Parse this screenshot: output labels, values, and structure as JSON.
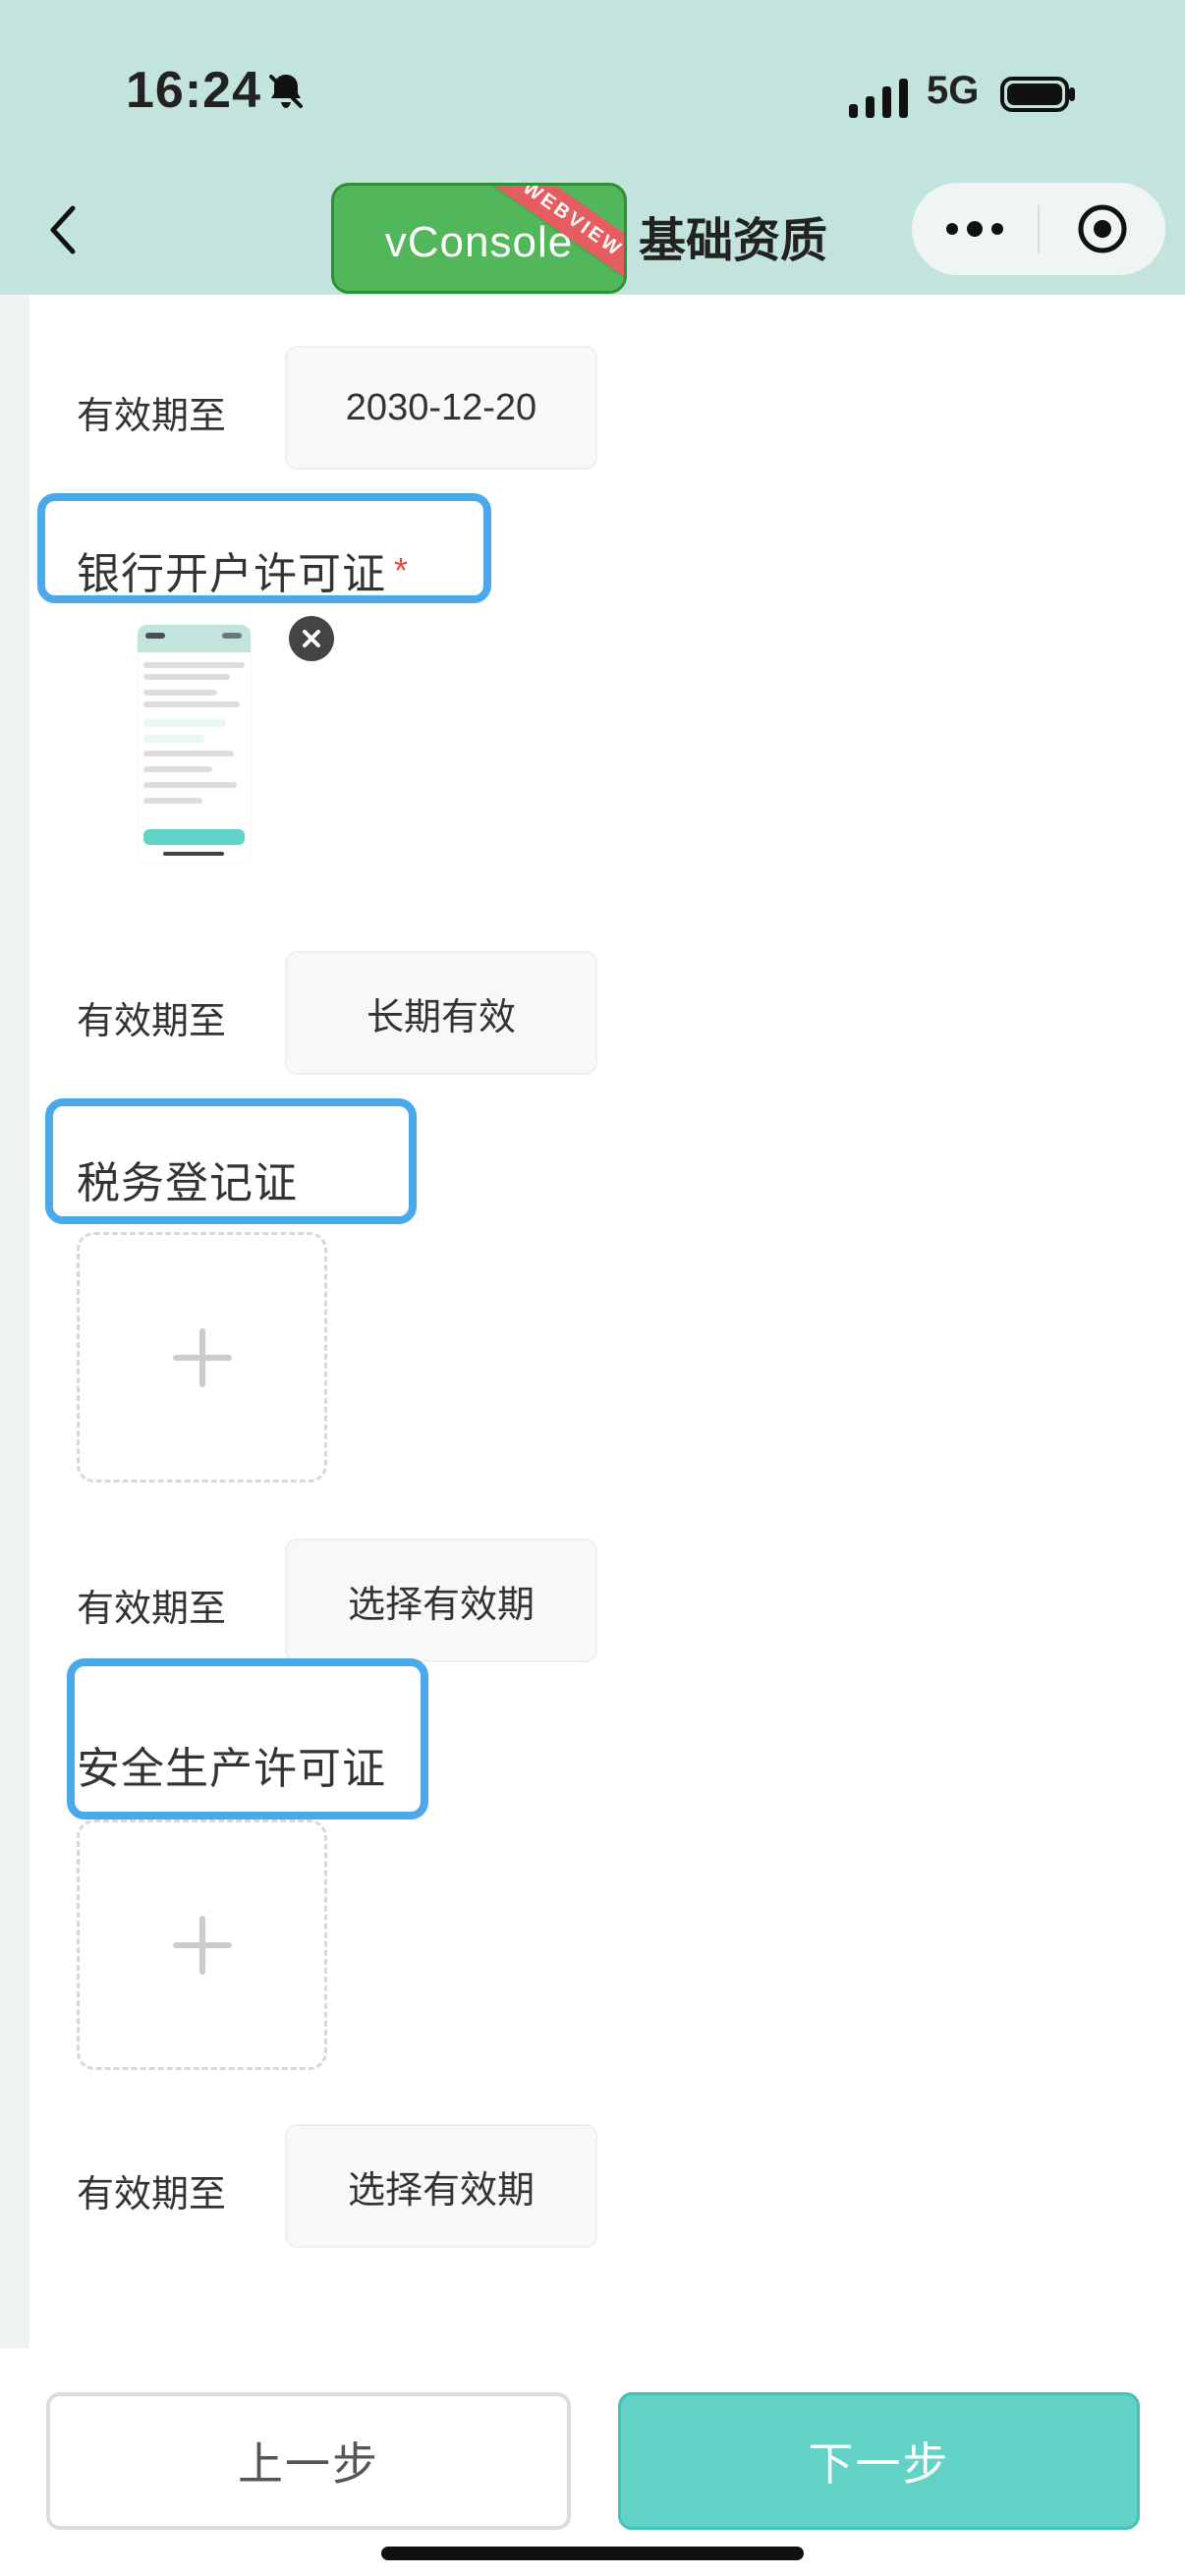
{
  "status_bar": {
    "time": "16:24",
    "network": "5G"
  },
  "header": {
    "vconsole_label": "vConsole",
    "vconsole_ribbon": "WEBVIEW",
    "title": "基础资质"
  },
  "form": {
    "validity_label": "有效期至",
    "business_license_validity": "2030-12-20",
    "bank_permit": {
      "title": "银行开户许可证",
      "required_mark": "*",
      "validity_value": "长期有效"
    },
    "tax_registration": {
      "title": "税务登记证",
      "validity_value": "选择有效期"
    },
    "safety_permit": {
      "title": "安全生产许可证",
      "validity_value": "选择有效期"
    }
  },
  "footer": {
    "prev_label": "上一步",
    "next_label": "下一步"
  },
  "colors": {
    "header_bg": "#c2e4dd",
    "primary": "#62d2c7",
    "highlight": "#4aa9ea",
    "required": "#e24c4c"
  },
  "icons": {
    "back": "chevron-left-icon",
    "more": "more-dots-icon",
    "target": "target-icon",
    "mute": "bell-slash-icon",
    "close": "close-icon",
    "add": "plus-icon"
  }
}
